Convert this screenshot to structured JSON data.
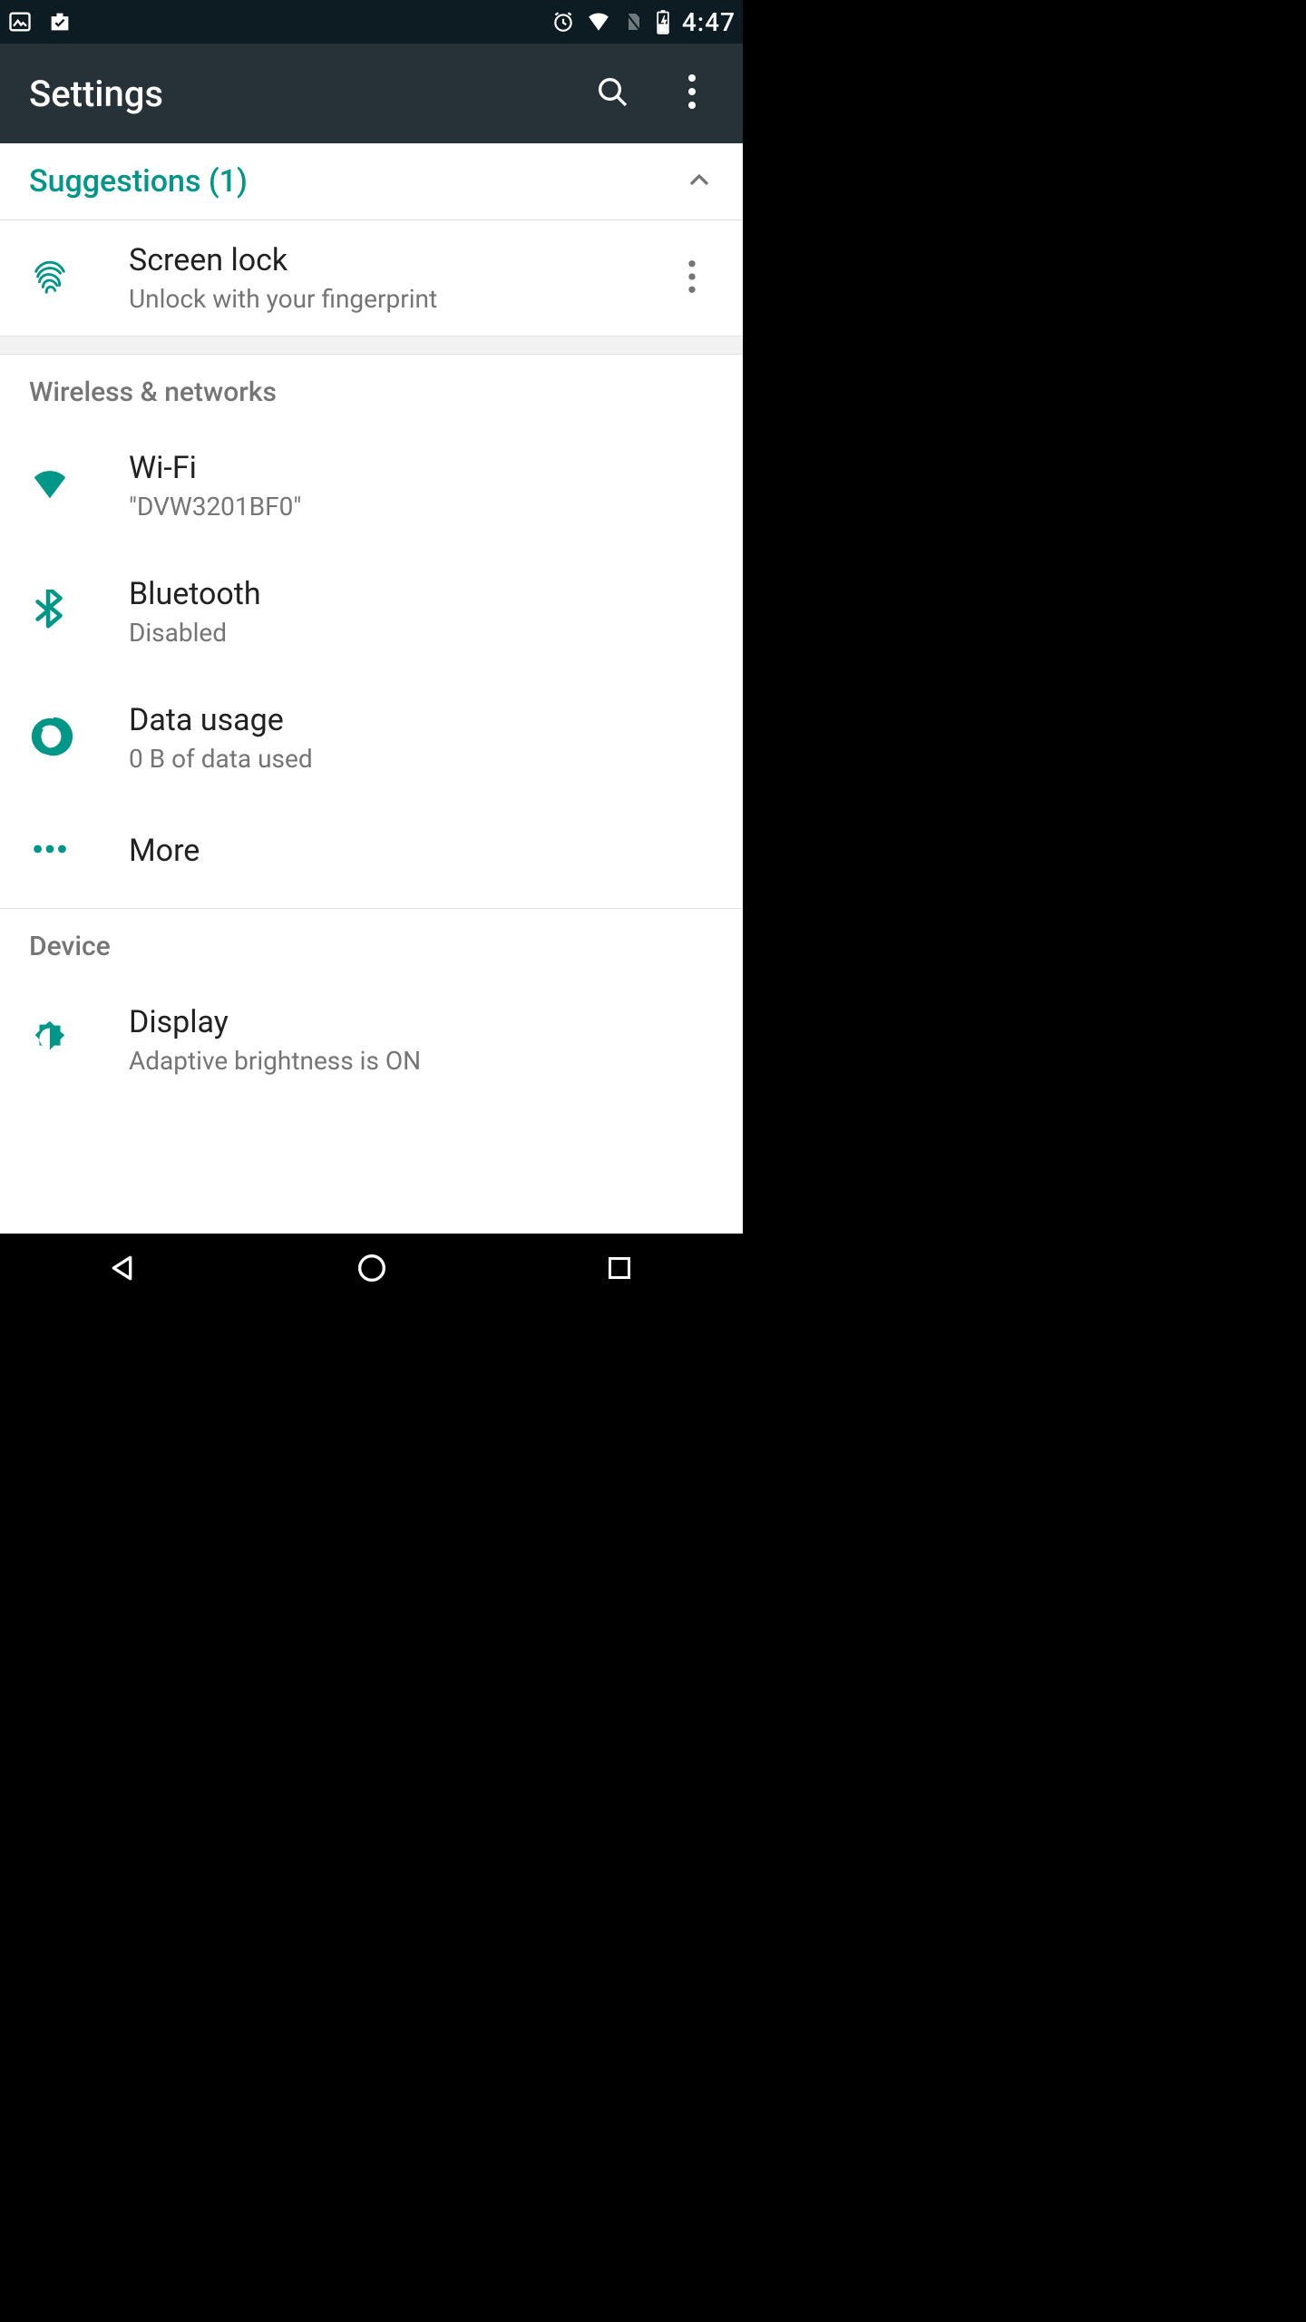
{
  "status_bar": {
    "time": "4:47"
  },
  "app_bar": {
    "title": "Settings"
  },
  "suggestions": {
    "header": "Suggestions (1)",
    "items": [
      {
        "title": "Screen lock",
        "subtitle": "Unlock with your fingerprint"
      }
    ]
  },
  "sections": {
    "wireless": {
      "header": "Wireless & networks",
      "items": [
        {
          "title": "Wi-Fi",
          "subtitle": "\"DVW3201BF0\""
        },
        {
          "title": "Bluetooth",
          "subtitle": "Disabled"
        },
        {
          "title": "Data usage",
          "subtitle": "0 B of data used"
        },
        {
          "title": "More"
        }
      ]
    },
    "device": {
      "header": "Device",
      "items": [
        {
          "title": "Display",
          "subtitle": "Adaptive brightness is ON"
        }
      ]
    }
  }
}
